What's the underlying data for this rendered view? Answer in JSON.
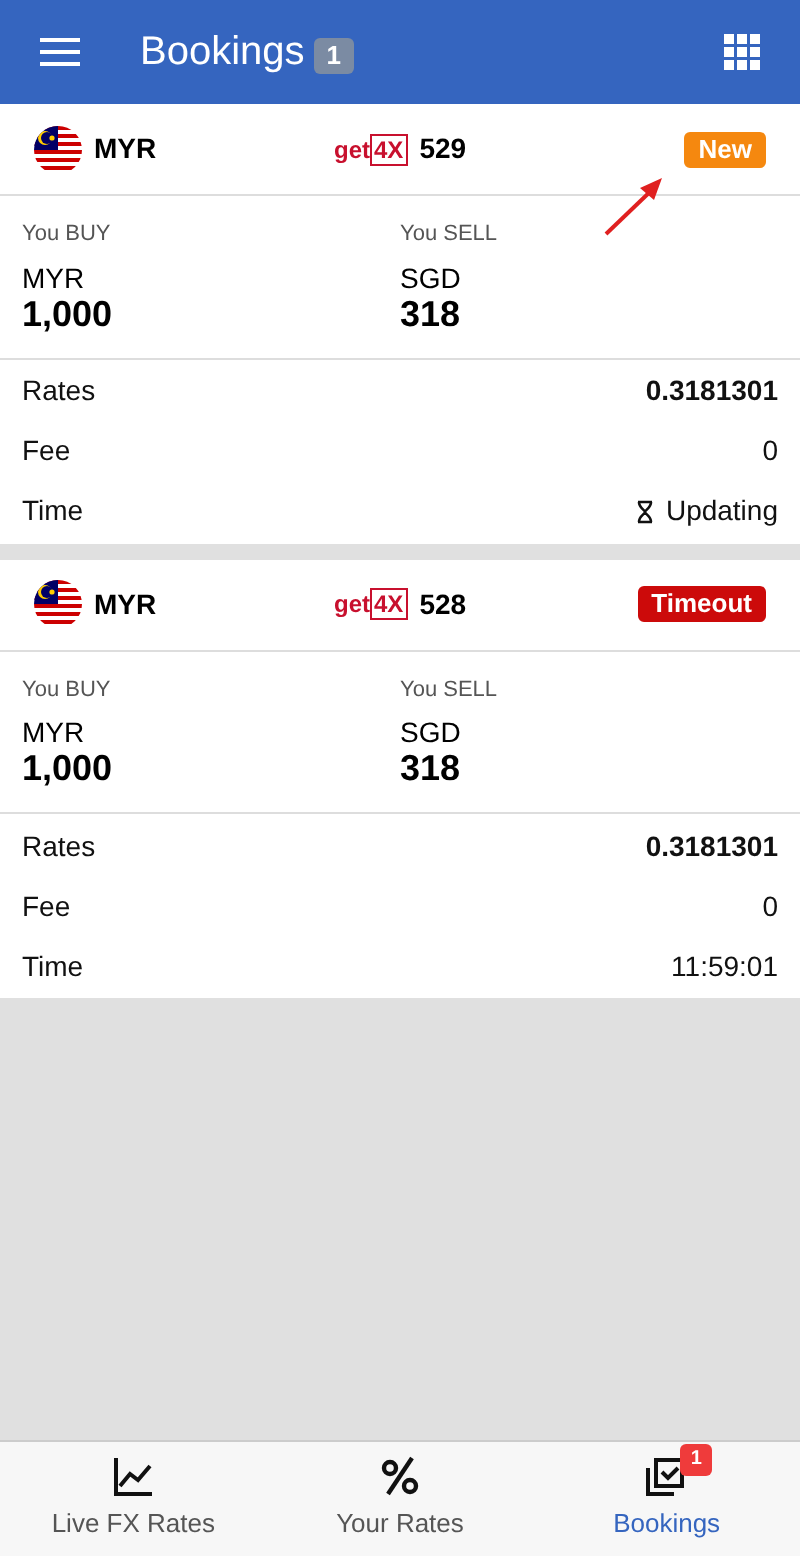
{
  "header": {
    "title": "Bookings",
    "count": "1"
  },
  "bookings": [
    {
      "currency": "MYR",
      "logo": {
        "prefix": "get",
        "suffix": "4X"
      },
      "number": "529",
      "status": {
        "kind": "new",
        "label": "New"
      },
      "buy_label": "You BUY",
      "buy_currency": "MYR",
      "buy_amount": "1,000",
      "sell_label": "You SELL",
      "sell_currency": "SGD",
      "sell_amount": "318",
      "rates_label": "Rates",
      "rates": "0.3181301",
      "fee_label": "Fee",
      "fee": "0",
      "time_label": "Time",
      "time": {
        "kind": "updating",
        "text": "Updating"
      }
    },
    {
      "currency": "MYR",
      "logo": {
        "prefix": "get",
        "suffix": "4X"
      },
      "number": "528",
      "status": {
        "kind": "timeout",
        "label": "Timeout"
      },
      "buy_label": "You BUY",
      "buy_currency": "MYR",
      "buy_amount": "1,000",
      "sell_label": "You SELL",
      "sell_currency": "SGD",
      "sell_amount": "318",
      "rates_label": "Rates",
      "rates": "0.3181301",
      "fee_label": "Fee",
      "fee": "0",
      "time_label": "Time",
      "time": {
        "kind": "clock",
        "text": "11:59:01"
      }
    }
  ],
  "nav": [
    {
      "kind": "chart",
      "label": "Live FX Rates",
      "selected": false
    },
    {
      "kind": "percent",
      "label": "Your Rates",
      "selected": false
    },
    {
      "kind": "bookings",
      "label": "Bookings",
      "selected": true,
      "badge": "1"
    }
  ]
}
